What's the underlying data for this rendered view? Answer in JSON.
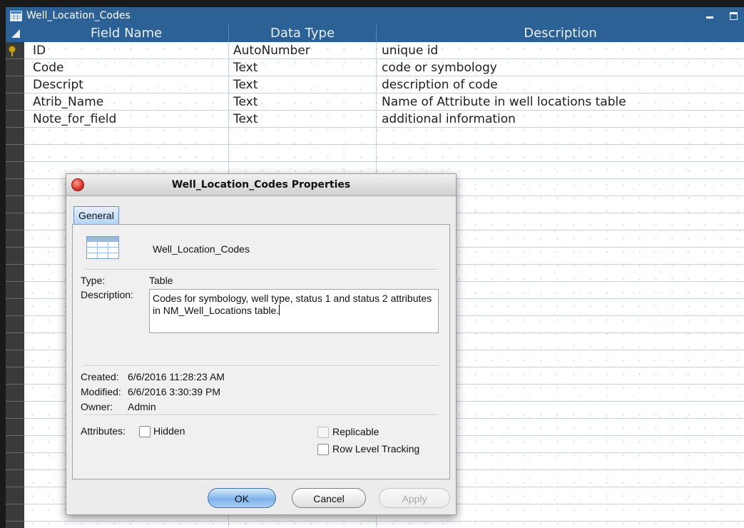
{
  "window": {
    "title": "Well_Location_Codes",
    "accent_color": "#2c6196"
  },
  "grid": {
    "columns": [
      "Field Name",
      "Data Type",
      "Description"
    ],
    "rows": [
      {
        "field": "ID",
        "type": "AutoNumber",
        "description": "unique id",
        "primary_key": true
      },
      {
        "field": "Code",
        "type": "Text",
        "description": "code or symbology"
      },
      {
        "field": "Descript",
        "type": "Text",
        "description": "description of code"
      },
      {
        "field": "Atrib_Name",
        "type": "Text",
        "description": "Name of Attribute in well locations table"
      },
      {
        "field": "Note_for_field",
        "type": "Text",
        "description": "additional information"
      }
    ]
  },
  "dialog": {
    "title": "Well_Location_Codes Properties",
    "tab": "General",
    "object_name": "Well_Location_Codes",
    "type_label": "Type:",
    "type_value": "Table",
    "description_label": "Description:",
    "description_value": "Codes for symbology, well type, status 1 and status 2 attributes in NM_Well_Locations table.",
    "created_label": "Created:",
    "created_value": "6/6/2016 11:28:23 AM",
    "modified_label": "Modified:",
    "modified_value": "6/6/2016 3:30:39 PM",
    "owner_label": "Owner:",
    "owner_value": "Admin",
    "attributes_label": "Attributes:",
    "hidden_label": "Hidden",
    "hidden_checked": false,
    "replicable_label": "Replicable",
    "replicable_checked": false,
    "row_level_tracking_label": "Row Level Tracking",
    "row_level_tracking_checked": false,
    "ok_label": "OK",
    "cancel_label": "Cancel",
    "apply_label": "Apply"
  }
}
